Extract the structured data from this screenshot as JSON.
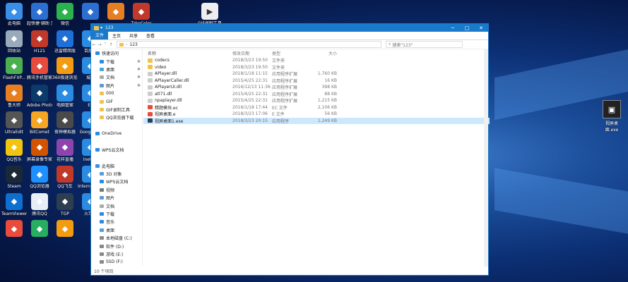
{
  "desktop": {
    "icons": [
      {
        "label": "此电脑",
        "icon": "computer-icon",
        "color": "#3a8ee6",
        "col": 0,
        "row": 0
      },
      {
        "label": "超快捷·辅助 加油",
        "icon": "app-icon",
        "color": "#2d6fd0",
        "col": 1,
        "row": 0
      },
      {
        "label": "微信",
        "icon": "wechat-icon",
        "color": "#2bb24c",
        "col": 2,
        "row": 0
      },
      {
        "label": "回收站",
        "icon": "recycle-bin-icon",
        "color": "#9ab",
        "col": 0,
        "row": 1
      },
      {
        "label": "H121",
        "icon": "h-icon",
        "color": "#c0392b",
        "col": 1,
        "row": 1
      },
      {
        "label": "迅雷精简版",
        "icon": "thunder-icon",
        "color": "#1f6fd6",
        "col": 2,
        "row": 1
      },
      {
        "label": "FlashFXP...",
        "icon": "flashfxp-icon",
        "color": "#4caf50",
        "col": 0,
        "row": 2
      },
      {
        "label": "腾讯手机管家",
        "icon": "guard-icon",
        "color": "#e74c3c",
        "col": 1,
        "row": 2
      },
      {
        "label": "360极速浏览器",
        "icon": "browser-icon",
        "color": "#f39c12",
        "col": 2,
        "row": 2
      },
      {
        "label": "鲁大师",
        "icon": "ludashi-icon",
        "color": "#e67e22",
        "col": 0,
        "row": 3
      },
      {
        "label": "Adobe Photosh...",
        "icon": "photoshop-icon",
        "color": "#0c3a6b",
        "col": 1,
        "row": 3
      },
      {
        "label": "电脑管家",
        "icon": "pcmanager-icon",
        "color": "#2a8be0",
        "col": 2,
        "row": 3
      },
      {
        "label": "UltraEdit",
        "icon": "ultraedit-icon",
        "color": "#555",
        "col": 0,
        "row": 4
      },
      {
        "label": "BitComet",
        "icon": "bitcomet-icon",
        "color": "#f5a623",
        "col": 1,
        "row": 4
      },
      {
        "label": "夜神模拟器",
        "icon": "nox-icon",
        "color": "#4a4a4a",
        "col": 2,
        "row": 4
      },
      {
        "label": "QQ音乐",
        "icon": "qqmusic-icon",
        "color": "#f1c40f",
        "col": 0,
        "row": 5
      },
      {
        "label": "屏幕录像专家 V2014",
        "icon": "recorder-icon",
        "color": "#d35400",
        "col": 1,
        "row": 5
      },
      {
        "label": "花样直播",
        "icon": "live-icon",
        "color": "#8e44ad",
        "col": 2,
        "row": 5
      },
      {
        "label": "Steam",
        "icon": "steam-icon",
        "color": "#1b2838",
        "col": 0,
        "row": 6
      },
      {
        "label": "QQ浏览器",
        "icon": "qqbrowser-icon",
        "color": "#1e90ff",
        "col": 1,
        "row": 6
      },
      {
        "label": "QQ飞车",
        "icon": "qqspeed-icon",
        "color": "#c0392b",
        "col": 2,
        "row": 6
      },
      {
        "label": "TeamViewer 13",
        "icon": "teamviewer-icon",
        "color": "#0e6fd1",
        "col": 0,
        "row": 7
      },
      {
        "label": "腾讯QQ",
        "icon": "qq-icon",
        "color": "#e8eef5",
        "col": 1,
        "row": 7
      },
      {
        "label": "TGP",
        "icon": "tgp-icon",
        "color": "#2c3e50",
        "col": 2,
        "row": 7
      },
      {
        "label": "",
        "icon": "app-icon",
        "color": "#e74c3c",
        "col": 0,
        "row": 8
      },
      {
        "label": "",
        "icon": "media-icon",
        "color": "#27ae60",
        "col": 1,
        "row": 8
      },
      {
        "label": "",
        "icon": "owl-icon",
        "color": "#f39c12",
        "col": 2,
        "row": 8
      }
    ],
    "partial_icons": [
      {
        "label": "百度网",
        "icon": "baidu-icon",
        "row": 1
      },
      {
        "label": "城通",
        "icon": "cloud-icon",
        "row": 2
      },
      {
        "label": "E4",
        "icon": "app-icon",
        "row": 3
      },
      {
        "label": "Goog chro",
        "icon": "chrome-icon",
        "row": 4
      },
      {
        "label": "InetMg",
        "icon": "idm-icon",
        "row": 5
      },
      {
        "label": "Intern Explo",
        "icon": "ie-icon",
        "row": 6
      },
      {
        "label": "火车车",
        "icon": "train-icon",
        "row": 7
      }
    ],
    "top_icons": [
      {
        "label": "",
        "icon": "app-icon",
        "color": "#2d6fd0"
      },
      {
        "label": "",
        "icon": "app-icon",
        "color": "#e67e22"
      },
      {
        "label": "TakeColor",
        "icon": "takecolor-icon",
        "color": "#c0392b"
      },
      {
        "label": "GIF录制工具",
        "icon": "gif-icon",
        "color": "#eee"
      }
    ],
    "right_icon": {
      "label": "视屏桌面.exe",
      "icon": "exe-icon"
    }
  },
  "window": {
    "title": "123",
    "ribbon_tabs": [
      "文件",
      "主页",
      "共享",
      "查看"
    ],
    "address": {
      "path": "123",
      "back_icon": "back-arrow-icon"
    },
    "search_placeholder": "搜索\"123\"",
    "nav_items": [
      {
        "label": "快速访问",
        "level": 1,
        "color": "#2a8be0",
        "pinned": false
      },
      {
        "label": "下载",
        "level": 2,
        "color": "#2a8be0",
        "pinned": true
      },
      {
        "label": "桌面",
        "level": 2,
        "color": "#4aa3df",
        "pinned": true
      },
      {
        "label": "文档",
        "level": 2,
        "color": "#aaa",
        "pinned": true
      },
      {
        "label": "图片",
        "level": 2,
        "color": "#5b9bd5",
        "pinned": true
      },
      {
        "label": "000",
        "level": 2,
        "color": "#f0c24a",
        "pinned": false
      },
      {
        "label": "GIF",
        "level": 2,
        "color": "#f0c24a",
        "pinned": false
      },
      {
        "label": "GIF录制工具",
        "level": 2,
        "color": "#f0c24a",
        "pinned": false
      },
      {
        "label": "QQ浏览器下载",
        "level": 2,
        "color": "#f0c24a",
        "pinned": false
      },
      {
        "label": "",
        "level": 2,
        "color": "",
        "pinned": false
      },
      {
        "label": "OneDrive",
        "level": 1,
        "color": "#2a8be0",
        "pinned": false
      },
      {
        "label": "",
        "level": 2,
        "color": "",
        "pinned": false
      },
      {
        "label": "WPS云文档",
        "level": 1,
        "color": "#2a8be0",
        "pinned": false
      },
      {
        "label": "",
        "level": 2,
        "color": "",
        "pinned": false
      },
      {
        "label": "此电脑",
        "level": 1,
        "color": "#3a8ee6",
        "pinned": false
      },
      {
        "label": "3D 对象",
        "level": 2,
        "color": "#5b9bd5",
        "pinned": false
      },
      {
        "label": "WPS云文档",
        "level": 2,
        "color": "#2a8be0",
        "pinned": false
      },
      {
        "label": "视频",
        "level": 2,
        "color": "#777",
        "pinned": false
      },
      {
        "label": "图片",
        "level": 2,
        "color": "#5b9bd5",
        "pinned": false
      },
      {
        "label": "文档",
        "level": 2,
        "color": "#aaa",
        "pinned": false
      },
      {
        "label": "下载",
        "level": 2,
        "color": "#2a8be0",
        "pinned": false
      },
      {
        "label": "音乐",
        "level": 2,
        "color": "#2a8be0",
        "pinned": false
      },
      {
        "label": "桌面",
        "level": 2,
        "color": "#4aa3df",
        "pinned": false
      },
      {
        "label": "本地磁盘 (C:)",
        "level": 2,
        "color": "#888",
        "pinned": false
      },
      {
        "label": "软件 (D:)",
        "level": 2,
        "color": "#888",
        "pinned": false
      },
      {
        "label": "游戏 (E:)",
        "level": 2,
        "color": "#888",
        "pinned": false
      },
      {
        "label": "SSD (F:)",
        "level": 2,
        "color": "#888",
        "pinned": false
      }
    ],
    "columns": {
      "name": "名称",
      "date": "修改日期",
      "type": "类型",
      "size": "大小"
    },
    "files": [
      {
        "name": "codecs",
        "date": "2018/3/23 19:50",
        "type": "文件夹",
        "size": "",
        "color": "#f0c24a",
        "selected": false
      },
      {
        "name": "video",
        "date": "2018/3/23 19:50",
        "type": "文件夹",
        "size": "",
        "color": "#f0c24a",
        "selected": false
      },
      {
        "name": "APlayer.dll",
        "date": "2018/1/18 11:15",
        "type": "应用程序扩展",
        "size": "1,760 KB",
        "color": "#ccc",
        "selected": false
      },
      {
        "name": "APlayerCaller.dll",
        "date": "2015/4/25 22:31",
        "type": "应用程序扩展",
        "size": "16 KB",
        "color": "#ccc",
        "selected": false
      },
      {
        "name": "APlayerUI.dll",
        "date": "2016/12/13 11:36",
        "type": "应用程序扩展",
        "size": "398 KB",
        "color": "#ccc",
        "selected": false
      },
      {
        "name": "atl71.dll",
        "date": "2015/4/25 22:31",
        "type": "应用程序扩展",
        "size": "88 KB",
        "color": "#ccc",
        "selected": false
      },
      {
        "name": "npaplayer.dll",
        "date": "2015/4/25 22:31",
        "type": "应用程序扩展",
        "size": "1,215 KB",
        "color": "#ccc",
        "selected": false
      },
      {
        "name": "精题模块.ec",
        "date": "2016/1/18 17:44",
        "type": "EC 文件",
        "size": "2,106 KB",
        "color": "#e74c3c",
        "selected": false
      },
      {
        "name": "视屏桌面.e",
        "date": "2018/3/23 17:06",
        "type": "E 文件",
        "size": "56 KB",
        "color": "#e74c3c",
        "selected": false
      },
      {
        "name": "视屏桌面1.exe",
        "date": "2018/3/23 20:15",
        "type": "应用程序",
        "size": "1,249 KB",
        "color": "#2c3e50",
        "selected": true
      }
    ],
    "status": "10 个项目"
  }
}
